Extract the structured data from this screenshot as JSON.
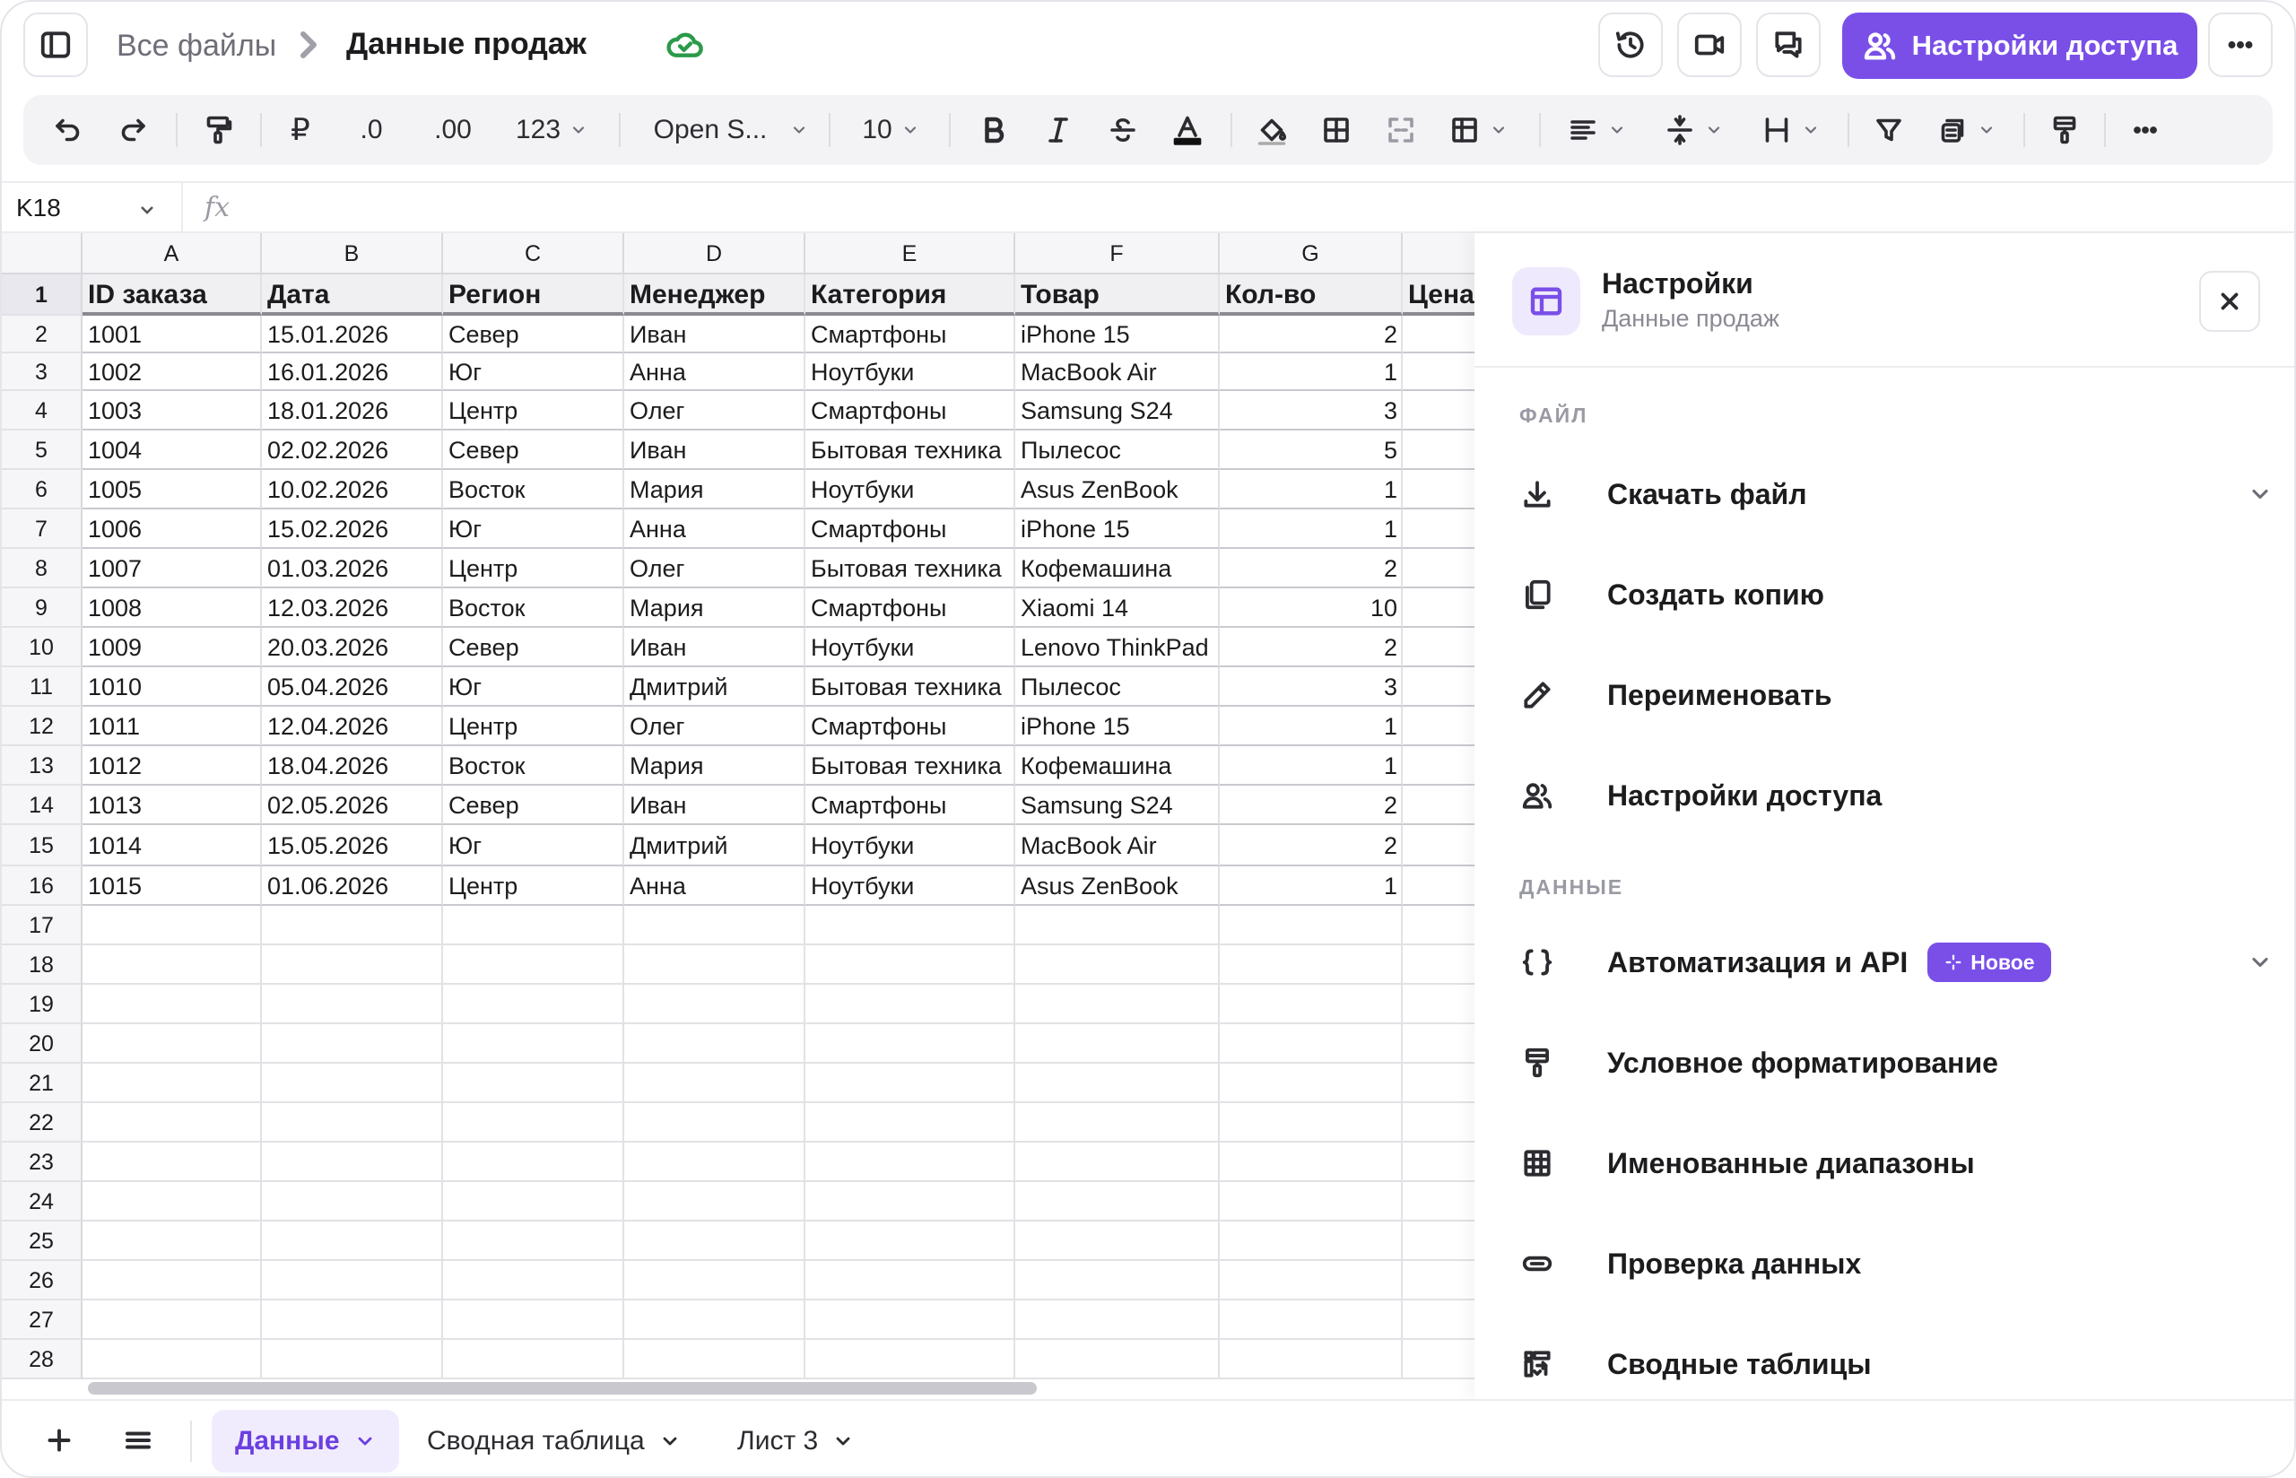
{
  "colors": {
    "accent": "#7a4fe8",
    "accent_bg": "#efe9fd",
    "ok": "#2b9a4a"
  },
  "header": {
    "breadcrumb_root": "Все файлы",
    "title": "Данные продаж",
    "share_label": "Настройки доступа",
    "icons": [
      "sidebar-toggle-icon",
      "chevron-right-icon",
      "cloud-check-icon",
      "history-icon",
      "video-icon",
      "comments-icon",
      "users-icon",
      "more-icon"
    ]
  },
  "toolbar": {
    "currency": "₽",
    "dec_less": ".0",
    "dec_more": ".00",
    "num_format": "123",
    "font": "Open S...",
    "font_size": "10"
  },
  "formula_bar": {
    "cell_ref": "K18",
    "fx": "fx",
    "value": ""
  },
  "sheet": {
    "columns": [
      "A",
      "B",
      "C",
      "D",
      "E",
      "F",
      "G"
    ],
    "header_row": [
      "ID заказа",
      "Дата",
      "Регион",
      "Менеджер",
      "Категория",
      "Товар",
      "Кол-во",
      "Цена"
    ],
    "rows": [
      [
        "1001",
        "15.01.2026",
        "Север",
        "Иван",
        "Смартфоны",
        "iPhone 15",
        "2"
      ],
      [
        "1002",
        "16.01.2026",
        "Юг",
        "Анна",
        "Ноутбуки",
        "MacBook Air",
        "1"
      ],
      [
        "1003",
        "18.01.2026",
        "Центр",
        "Олег",
        "Смартфоны",
        "Samsung S24",
        "3"
      ],
      [
        "1004",
        "02.02.2026",
        "Север",
        "Иван",
        "Бытовая техника",
        "Пылесос",
        "5"
      ],
      [
        "1005",
        "10.02.2026",
        "Восток",
        "Мария",
        "Ноутбуки",
        "Asus ZenBook",
        "1"
      ],
      [
        "1006",
        "15.02.2026",
        "Юг",
        "Анна",
        "Смартфоны",
        "iPhone 15",
        "1"
      ],
      [
        "1007",
        "01.03.2026",
        "Центр",
        "Олег",
        "Бытовая техника",
        "Кофемашина",
        "2"
      ],
      [
        "1008",
        "12.03.2026",
        "Восток",
        "Мария",
        "Смартфоны",
        "Xiaomi 14",
        "10"
      ],
      [
        "1009",
        "20.03.2026",
        "Север",
        "Иван",
        "Ноутбуки",
        "Lenovo ThinkPad",
        "2"
      ],
      [
        "1010",
        "05.04.2026",
        "Юг",
        "Дмитрий",
        "Бытовая техника",
        "Пылесос",
        "3"
      ],
      [
        "1011",
        "12.04.2026",
        "Центр",
        "Олег",
        "Смартфоны",
        "iPhone 15",
        "1"
      ],
      [
        "1012",
        "18.04.2026",
        "Восток",
        "Мария",
        "Бытовая техника",
        "Кофемашина",
        "1"
      ],
      [
        "1013",
        "02.05.2026",
        "Север",
        "Иван",
        "Смартфоны",
        "Samsung S24",
        "2"
      ],
      [
        "1014",
        "15.05.2026",
        "Юг",
        "Дмитрий",
        "Ноутбуки",
        "MacBook Air",
        "2"
      ],
      [
        "1015",
        "01.06.2026",
        "Центр",
        "Анна",
        "Ноутбуки",
        "Asus ZenBook",
        "1"
      ]
    ],
    "row_numbers": [
      "1",
      "2",
      "3",
      "4",
      "5",
      "6",
      "7",
      "8",
      "9",
      "10",
      "11",
      "12",
      "13",
      "14",
      "15",
      "16",
      "17",
      "18",
      "19",
      "20",
      "21",
      "22",
      "23",
      "24",
      "25",
      "26",
      "27",
      "28"
    ]
  },
  "panel": {
    "title": "Настройки",
    "subtitle": "Данные продаж",
    "section_file": "ФАЙЛ",
    "section_data": "ДАННЫЕ",
    "items": [
      {
        "label": "Скачать файл",
        "icon": "download-icon"
      },
      {
        "label": "Создать копию",
        "icon": "copy-icon"
      },
      {
        "label": "Переименовать",
        "icon": "pencil-icon"
      },
      {
        "label": "Настройки доступа",
        "icon": "users-icon"
      },
      {
        "label": "Автоматизация и API",
        "icon": "braces-icon",
        "badge": "Новое"
      },
      {
        "label": "Условное форматирование",
        "icon": "paint-roller-icon"
      },
      {
        "label": "Именованные диапазоны",
        "icon": "grid-icon"
      },
      {
        "label": "Проверка данных",
        "icon": "toggle-icon"
      },
      {
        "label": "Сводные таблицы",
        "icon": "pivot-icon"
      }
    ]
  },
  "sheet_tabs": [
    "Данные",
    "Сводная таблица",
    "Лист 3"
  ]
}
